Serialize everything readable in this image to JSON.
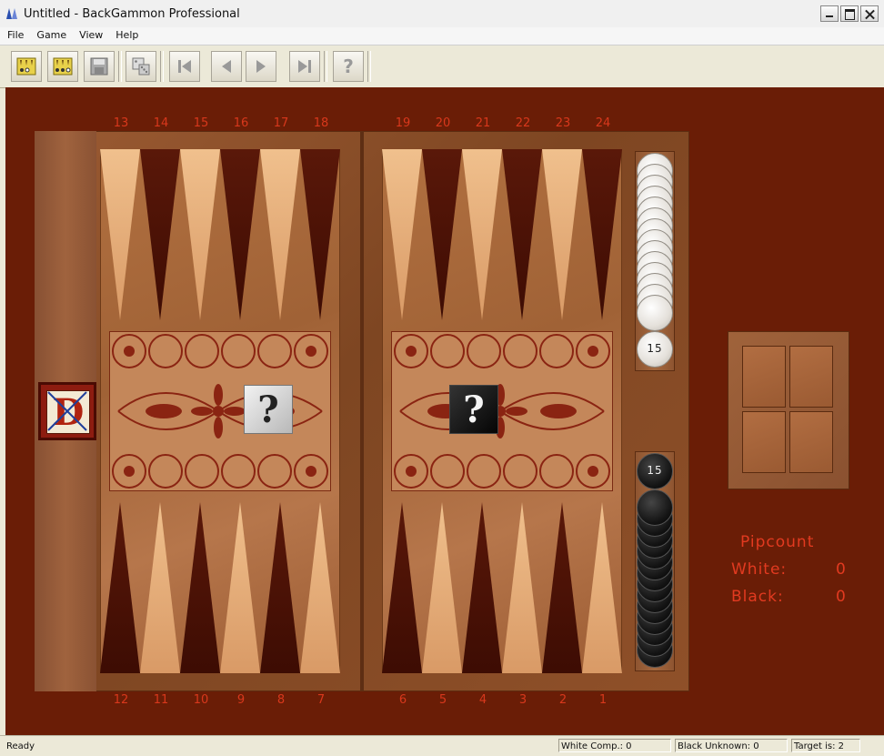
{
  "window": {
    "title": "Untitled - BackGammon Professional"
  },
  "menu": [
    "File",
    "Game",
    "View",
    "Help"
  ],
  "toolbar": {
    "buttons": [
      "new-game-icon",
      "new-match-icon",
      "save-icon",
      "dice-icon",
      "first-move-icon",
      "previous-move-icon",
      "next-move-icon",
      "last-move-icon",
      "help-icon"
    ]
  },
  "board": {
    "top_points": [
      "13",
      "14",
      "15",
      "16",
      "17",
      "18",
      "19",
      "20",
      "21",
      "22",
      "23",
      "24"
    ],
    "bottom_points": [
      "12",
      "11",
      "10",
      "9",
      "8",
      "7",
      "6",
      "5",
      "4",
      "3",
      "2",
      "1"
    ],
    "white_off_count": "15",
    "black_off_count": "15",
    "white_die": "?",
    "black_die": "?",
    "cube_letter": "D"
  },
  "pipcount": {
    "title": "Pipcount",
    "white_label": "White:",
    "white_value": "0",
    "black_label": "Black:",
    "black_value": "0"
  },
  "status": {
    "ready": "Ready",
    "white": "White Comp.: 0",
    "black": "Black Unknown: 0",
    "target": "Target is: 2"
  },
  "colors": {
    "background": "#6a1d06",
    "numbers": "#d8381c",
    "pipcount": "#e23a20"
  }
}
